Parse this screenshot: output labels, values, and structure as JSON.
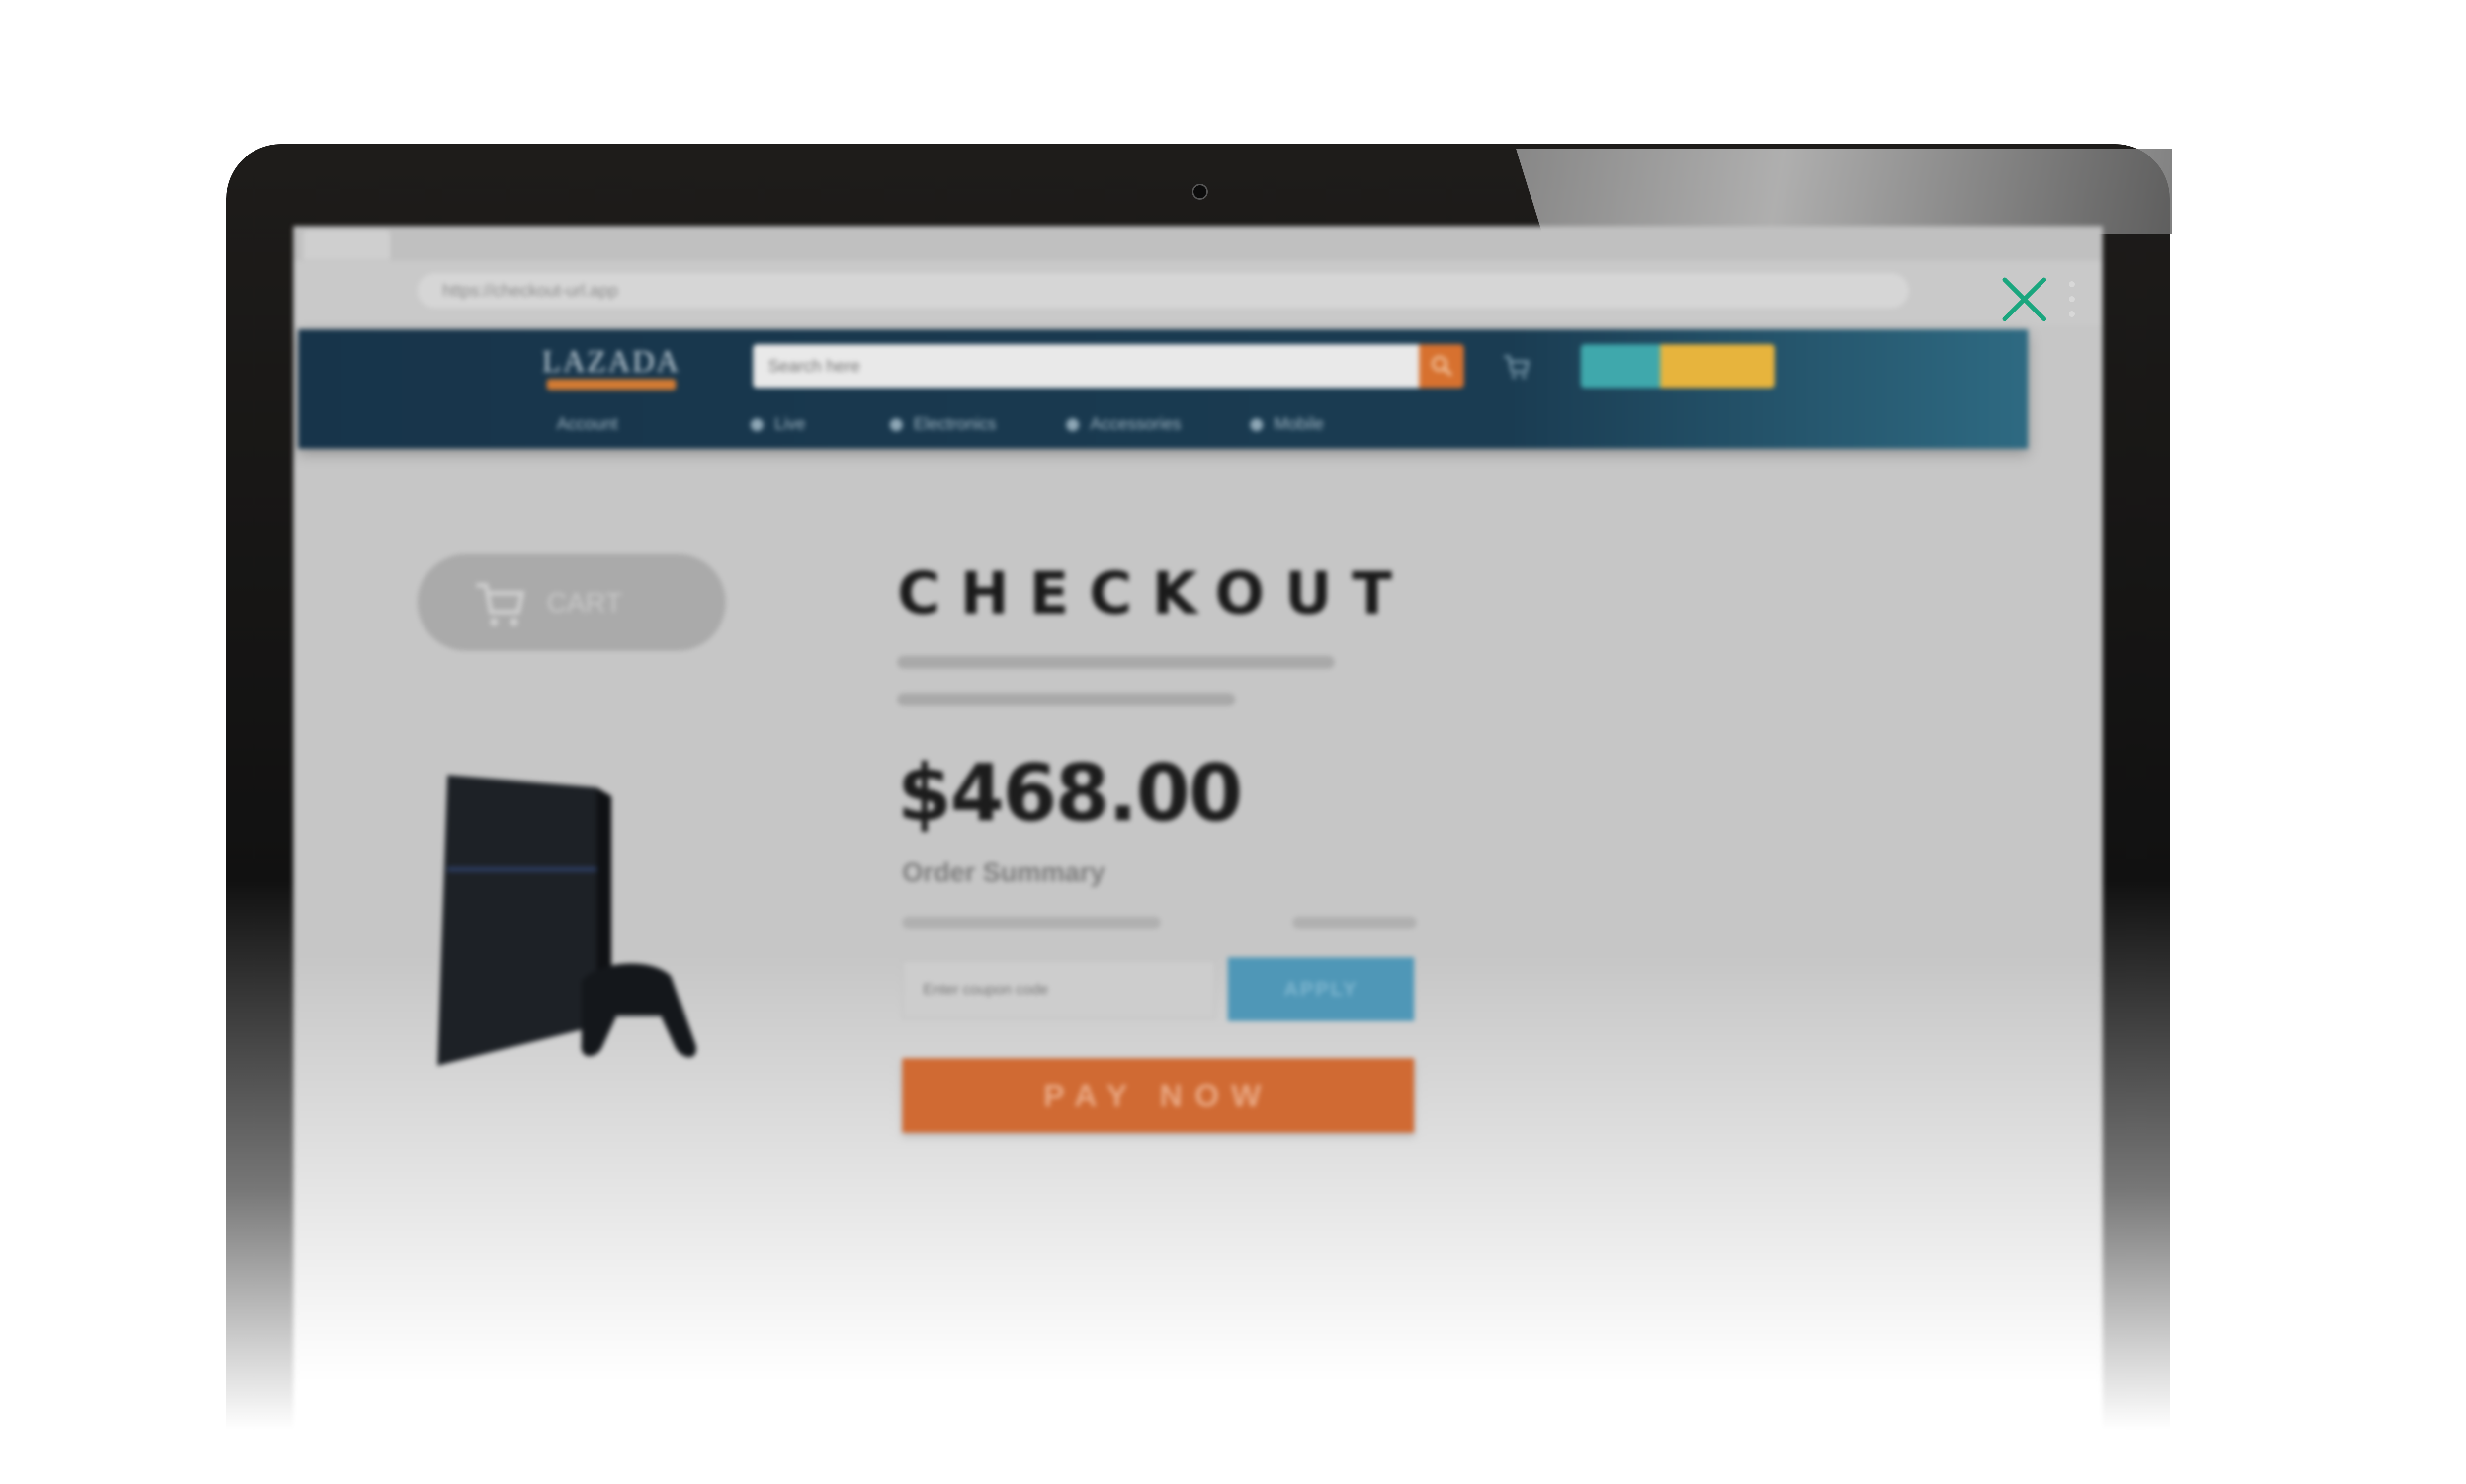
{
  "browser": {
    "url": "https://checkout-url.app"
  },
  "site": {
    "logo_text": "LAZADA",
    "search_placeholder": "Search here",
    "nav": [
      {
        "label": "Live"
      },
      {
        "label": "Electronics"
      },
      {
        "label": "Accessories"
      },
      {
        "label": "Mobile"
      }
    ],
    "account_label": "Account"
  },
  "checkout": {
    "cart_label": "CART",
    "title": "CHECKOUT",
    "price": "$468.00",
    "summary_heading": "Order Summary",
    "coupon_placeholder": "Enter coupon code",
    "apply_label": "APPLY",
    "pay_label": "PAY NOW"
  },
  "colors": {
    "header": "#17344a",
    "accent_orange": "#d06a33",
    "apply_blue": "#4f97b7",
    "close_green": "#1aa67e"
  },
  "icons": [
    "search-icon",
    "cart-icon",
    "close-icon",
    "kebab-menu-icon"
  ]
}
